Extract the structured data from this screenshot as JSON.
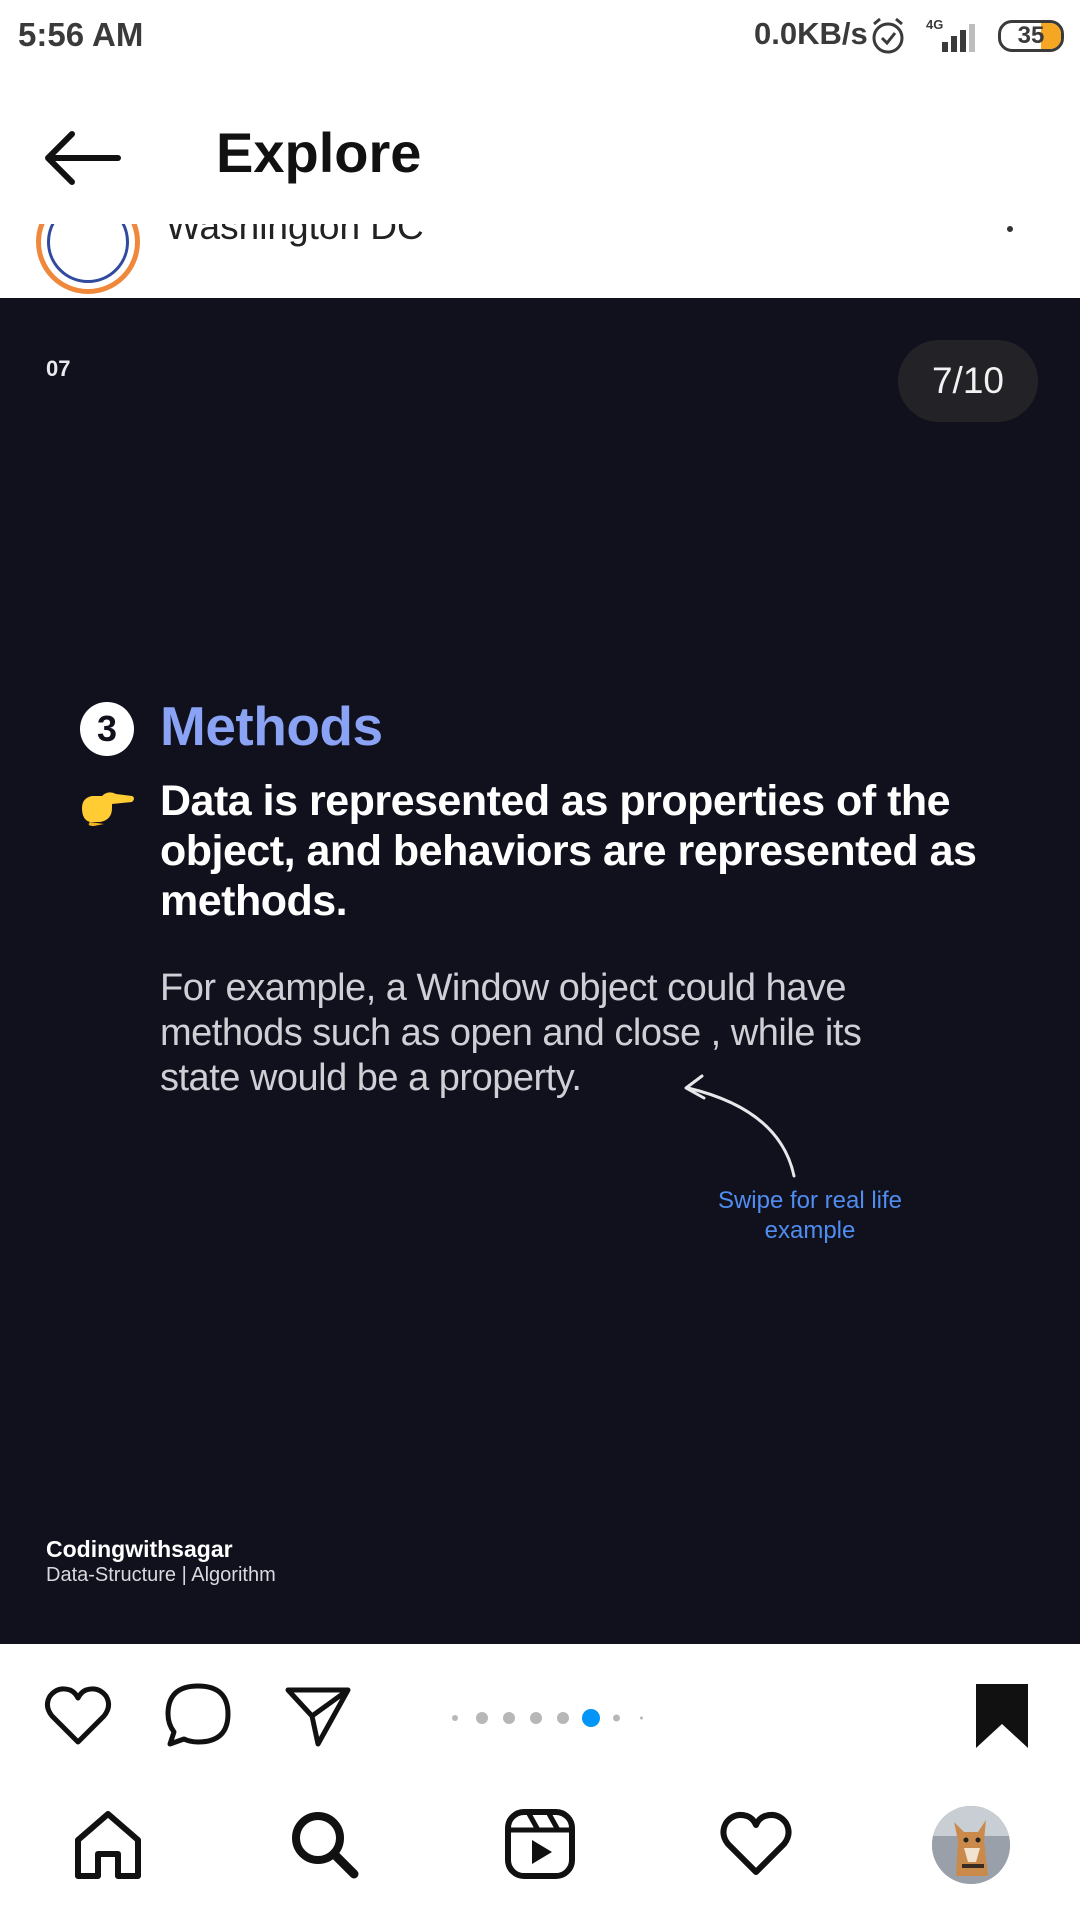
{
  "status_bar": {
    "time": "5:56 AM",
    "network_speed": "0.0KB/s",
    "network_type": "4G",
    "battery": "35",
    "icons": [
      "alarm-icon",
      "signal-icon",
      "battery-icon"
    ]
  },
  "header": {
    "title": "Explore",
    "back_icon": "arrow-left-icon"
  },
  "post": {
    "location": "Washington DC",
    "slide": {
      "number": "07",
      "counter": "7/10",
      "item_number": "3",
      "heading": "Methods",
      "main_text": "Data is represented as properties of the object, and behaviors are represented as methods.",
      "body_text": "For example, a Window object could have methods such as open and close , while its state would be a property.",
      "swipe_note": "Swipe for real life example",
      "brand_name": "Codingwithsagar",
      "brand_tagline": "Data-Structure | Algorithm",
      "colors": {
        "background": "#10111c",
        "heading": "#8aa3f5",
        "swipe_note": "#4f8df0"
      }
    },
    "carousel": {
      "current_index": 7,
      "visible_dots": 7
    },
    "actions": {
      "icons": [
        "heart-icon",
        "comment-icon",
        "share-icon",
        "bookmark-icon"
      ]
    }
  },
  "bottom_nav": {
    "icons": [
      "home-icon",
      "search-icon",
      "reels-icon",
      "activity-heart-icon",
      "profile-avatar"
    ],
    "accent": "#0095f6"
  }
}
